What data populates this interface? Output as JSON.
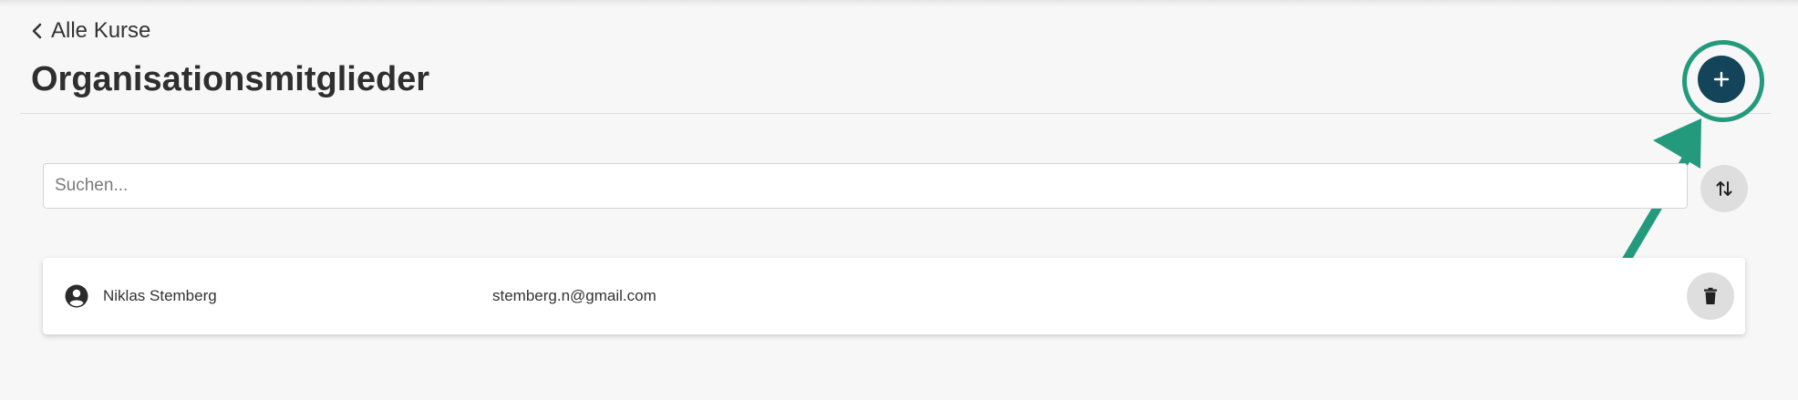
{
  "header": {
    "back_label": "Alle Kurse",
    "title": "Organisationsmitglieder",
    "add_button_icon": "plus-icon"
  },
  "search": {
    "placeholder": "Suchen...",
    "value": ""
  },
  "sort_button_icon": "sort-arrows-icon",
  "members": [
    {
      "avatar_icon": "account-circle-icon",
      "name": "Niklas Stemberg",
      "email": "stemberg.n@gmail.com",
      "delete_icon": "trash-icon"
    }
  ],
  "colors": {
    "background": "#f7f7f7",
    "add_button": "#14445a",
    "annotation": "#239a7b",
    "secondary_button": "#dedede"
  }
}
